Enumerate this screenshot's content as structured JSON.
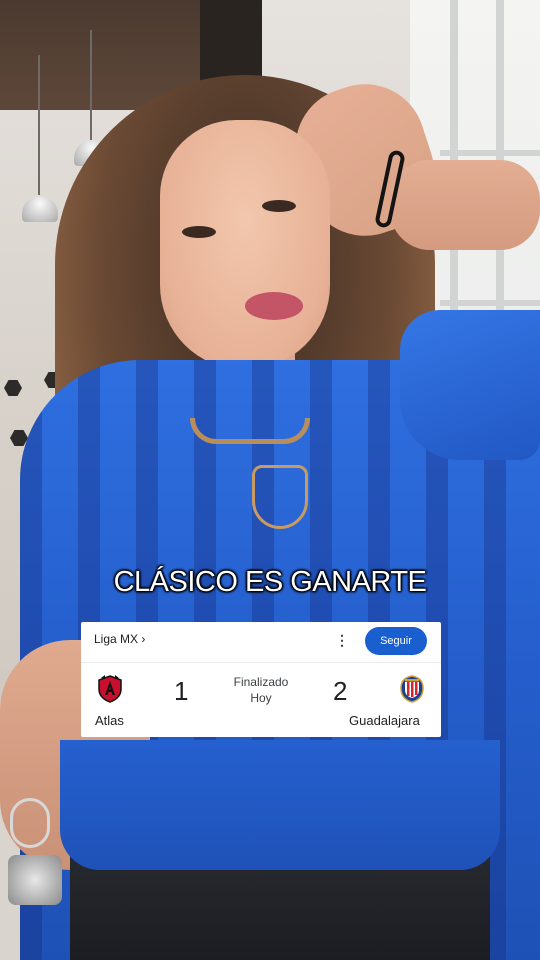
{
  "caption": "CLÁSICO ES GANARTE",
  "match_card": {
    "league": "Liga MX",
    "league_chevron": "›",
    "menu_icon": "kebab-menu-icon",
    "follow_label": "Seguir",
    "status": "Finalizado",
    "date": "Hoy",
    "home_team": {
      "name": "Atlas",
      "score": "1",
      "logo": "atlas-crest-icon"
    },
    "away_team": {
      "name": "Guadalajara",
      "score": "2",
      "logo": "chivas-crest-icon"
    }
  },
  "colors": {
    "follow_button": "#1a5fd0",
    "caption_text": "#ffffff",
    "card_background": "#ffffff"
  }
}
